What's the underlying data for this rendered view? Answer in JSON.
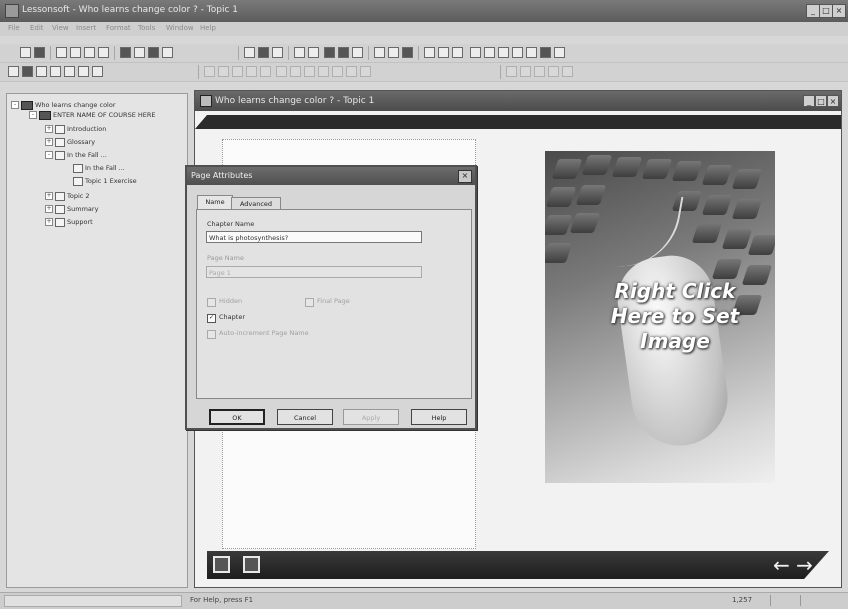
{
  "app": {
    "title": "Lessonsoft - Who learns change color ? - Topic 1",
    "window_controls": [
      "_",
      "□",
      "×"
    ]
  },
  "menu": {
    "items": [
      "File",
      "Edit",
      "View",
      "Insert",
      "Format",
      "Tools",
      "Window",
      "Help"
    ]
  },
  "tree": {
    "items": [
      {
        "label": "Who learns change color",
        "level": 0,
        "icon": "book",
        "expander": "-"
      },
      {
        "label": "ENTER NAME OF COURSE HERE",
        "level": 1,
        "icon": "book",
        "expander": "-"
      },
      {
        "label": "Introduction",
        "level": 2,
        "icon": "folder",
        "expander": "+"
      },
      {
        "label": "Glossary",
        "level": 2,
        "icon": "folder",
        "expander": "+"
      },
      {
        "label": "In the Fall ...",
        "level": 2,
        "icon": "folder",
        "expander": "-"
      },
      {
        "label": "In the Fall ...",
        "level": 3,
        "icon": "page",
        "expander": ""
      },
      {
        "label": "Topic 1 Exercise",
        "level": 3,
        "icon": "page",
        "expander": ""
      },
      {
        "label": "Topic 2",
        "level": 2,
        "icon": "folder",
        "expander": "+"
      },
      {
        "label": "Summary",
        "level": 2,
        "icon": "folder",
        "expander": "+"
      },
      {
        "label": "Support",
        "level": 2,
        "icon": "folder",
        "expander": "+"
      }
    ]
  },
  "document": {
    "title": "Who learns change color ? - Topic 1",
    "image_placeholder_text": "Right Click Here to Set Image",
    "nav_arrows": "← →"
  },
  "dialog": {
    "title": "Page Attributes",
    "close": "×",
    "tabs": [
      {
        "label": "Name",
        "active": true
      },
      {
        "label": "Advanced",
        "active": false
      }
    ],
    "chapter_name_label": "Chapter Name",
    "chapter_name_value": "What is photosynthesis?",
    "page_name_label": "Page Name",
    "page_name_value": "Page 1",
    "checkboxes": [
      {
        "label": "Hidden",
        "checked": false,
        "enabled": false
      },
      {
        "label": "Final Page",
        "checked": false,
        "enabled": false
      },
      {
        "label": "Chapter",
        "checked": true,
        "enabled": true
      },
      {
        "label": "Auto-increment Page Name",
        "checked": false,
        "enabled": false
      }
    ],
    "buttons": {
      "ok": "OK",
      "cancel": "Cancel",
      "apply": "Apply",
      "help": "Help"
    }
  },
  "status": {
    "help_text": "For Help, press F1",
    "position": "1,257"
  },
  "colors": {
    "title_bar": "#5c5c5c",
    "nav_bar": "#1e1e1e",
    "window_bg": "#d7d7d7"
  }
}
